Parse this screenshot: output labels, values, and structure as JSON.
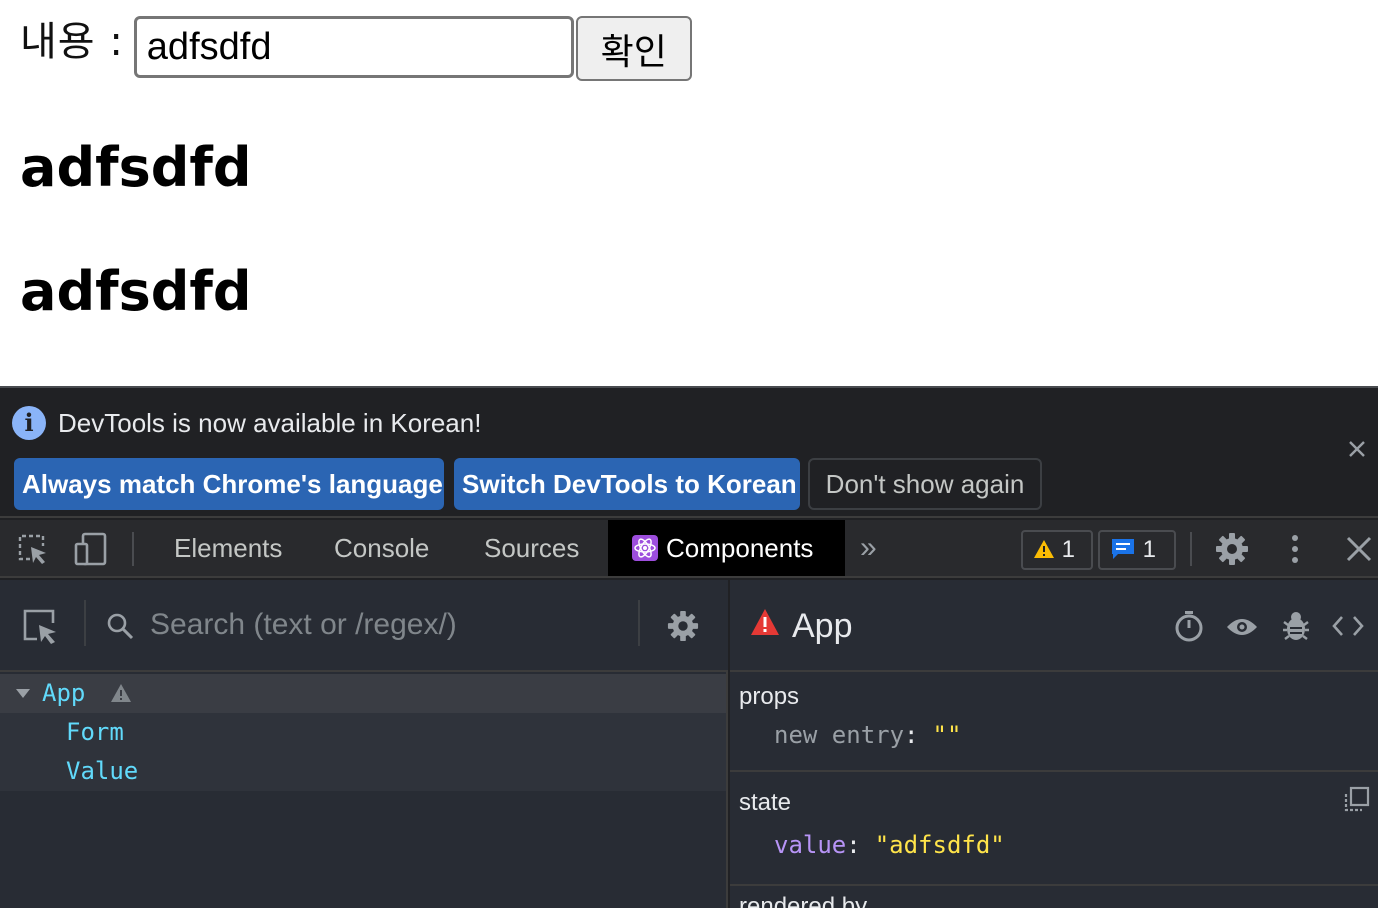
{
  "page": {
    "form_label": "내용 :",
    "input_value": "adfsdfd",
    "confirm_label": "확인",
    "headings": [
      "adfsdfd",
      "adfsdfd"
    ]
  },
  "devtools": {
    "infobar": {
      "message": "DevTools is now available in Korean!",
      "buttons": [
        "Always match Chrome's language",
        "Switch DevTools to Korean",
        "Don't show again"
      ]
    },
    "tabs": [
      "Elements",
      "Console",
      "Sources",
      "Components"
    ],
    "active_tab": "Components",
    "warnings_count": "1",
    "messages_count": "1",
    "components": {
      "search_placeholder": "Search (text or /regex/)",
      "tree": [
        {
          "name": "App",
          "depth": 0,
          "warning": true
        },
        {
          "name": "Form",
          "depth": 1
        },
        {
          "name": "Value",
          "depth": 1
        }
      ],
      "selected": {
        "title": "App",
        "props_title": "props",
        "props": [
          {
            "key": "new entry",
            "value": "\"\""
          }
        ],
        "state_title": "state",
        "state": [
          {
            "key": "value",
            "value": "\"adfsdfd\""
          }
        ],
        "rendered_by_title": "rendered by"
      }
    },
    "colors": {
      "background": "#202124",
      "panel": "#282c34",
      "primary_button": "#2b65b3",
      "component_name": "#61dafb",
      "string_value": "#ffe44a",
      "state_key": "#b794f6",
      "warning_red": "#e53935"
    }
  }
}
